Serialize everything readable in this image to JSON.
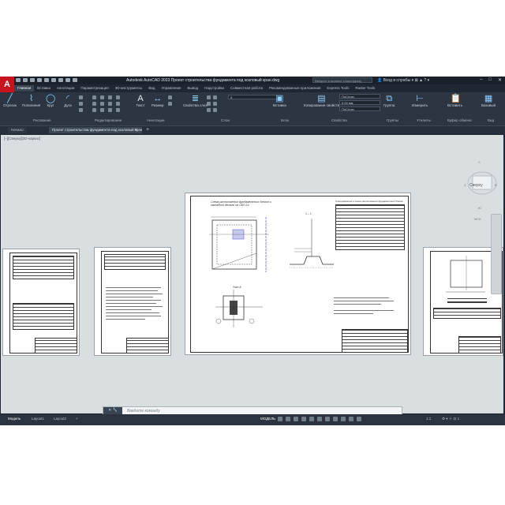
{
  "titlebar": {
    "logo": "A",
    "title": "Autodesk AutoCAD 2023   Проект строительства фундамента под козловый кран.dwg",
    "search_placeholder": "Введите ключевое слово/фразу",
    "user": "Вход в службы"
  },
  "ribbon_tabs": [
    "Главная",
    "Вставка",
    "Аннотации",
    "Параметризация",
    "3D-инструменты",
    "Вид",
    "Управление",
    "Вывод",
    "Надстройки",
    "Совместная работа",
    "Рекомендованные приложения",
    "Express Tools",
    "Raster Tools"
  ],
  "ribbon_tabs_active": 0,
  "ribbon": {
    "draw_tools": [
      "Отрезок",
      "Полилиния",
      "Круг",
      "Дуга"
    ],
    "panels": [
      "Рисование",
      "Редактирование",
      "Аннотации",
      "Слои",
      "Блок",
      "Свойства",
      "Группы",
      "Утилиты",
      "Буфер обмена",
      "Вид"
    ],
    "annot_tools": [
      "Текст",
      "Размер"
    ],
    "layer_props": "Свойства слоя",
    "layer_combo": "0",
    "insert": "Вставка",
    "match_props": "Копирование свойств",
    "bylayer": "ПоСлою",
    "linetype": "0.00 мм",
    "lineweight": "ПоСлою",
    "group": "Группа",
    "measure": "Измерить",
    "paste": "Вставить",
    "base": "Базовый"
  },
  "doc_tabs": [
    "Начало",
    "Проект строительства фундамента под козловый кран"
  ],
  "doc_tab_active": 1,
  "viewport_label": "[–][Сверху][2D-каркас]",
  "navcube": {
    "face": "Сверху",
    "north": "С",
    "south": "Ю",
    "west": "З",
    "east": "В",
    "wcs": "МСК"
  },
  "command_placeholder": "Введите команду",
  "layout_tabs": [
    "Модель",
    "Layout1",
    "Layout2"
  ],
  "layout_active": 0,
  "status": {
    "model": "МОДЕЛЬ",
    "scale": "1:1"
  },
  "sheet_titles": {
    "center_note": "Схема расположения фундаментных блоков и закладной детали   на ОКП-16",
    "section": "1 – 1",
    "detail": "Узел А",
    "table_header": "Спецификация к схеме расположения фундаментных блоков"
  }
}
